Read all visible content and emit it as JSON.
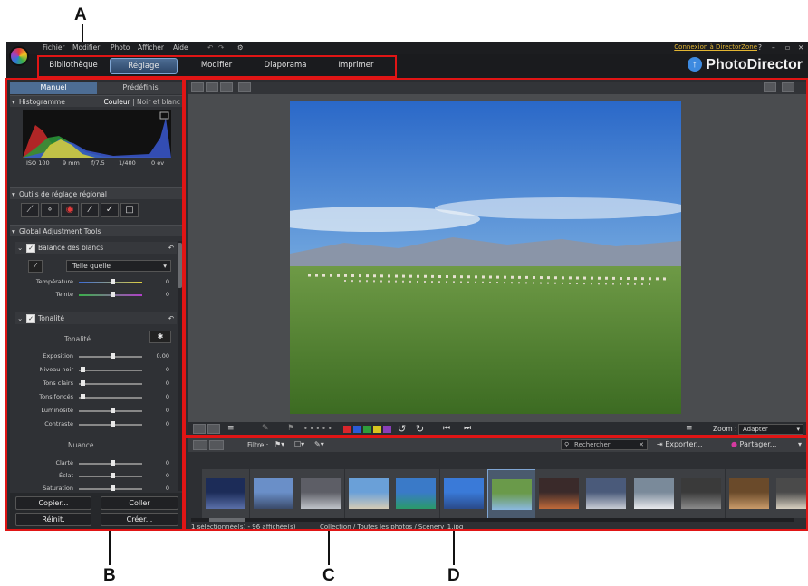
{
  "callouts": {
    "a": "A",
    "b": "B",
    "c": "C",
    "d": "D"
  },
  "menu": {
    "items": [
      "Fichier",
      "Modifier",
      "Photo",
      "Afficher",
      "Aide"
    ]
  },
  "header": {
    "directorzone_link": "Connexion à DirectorZone",
    "help": "?",
    "brand": "PhotoDirector",
    "tabs": [
      "Bibliothèque",
      "Réglage",
      "Modifier",
      "Diaporama",
      "Imprimer"
    ],
    "active_tab": "Réglage"
  },
  "left_panel": {
    "tabs": [
      "Manuel",
      "Prédéfinis"
    ],
    "histogram": {
      "title": "Histogramme",
      "mode_color": "Couleur",
      "mode_separator": "|",
      "mode_bw": "Noir et blanc",
      "exif": [
        "ISO 100",
        "9 mm",
        "f/7.5",
        "1/400",
        "0 ev"
      ]
    },
    "regional_tools_title": "Outils de réglage régional",
    "global_tools_title": "Global Adjustment Tools",
    "white_balance": {
      "title": "Balance des blancs",
      "preset": "Telle quelle",
      "sliders": [
        {
          "label": "Température",
          "value": "0"
        },
        {
          "label": "Teinte",
          "value": "0"
        }
      ]
    },
    "tonality": {
      "title": "Tonalité",
      "subtitle": "Tonalité",
      "sliders": [
        {
          "label": "Exposition",
          "value": "0.00"
        },
        {
          "label": "Niveau noir",
          "value": "0"
        },
        {
          "label": "Tons clairs",
          "value": "0"
        },
        {
          "label": "Tons foncés",
          "value": "0"
        },
        {
          "label": "Luminosité",
          "value": "0"
        },
        {
          "label": "Contraste",
          "value": "0"
        }
      ]
    },
    "nuance": {
      "title": "Nuance",
      "sliders": [
        {
          "label": "Clarté",
          "value": "0"
        },
        {
          "label": "Éclat",
          "value": "0"
        },
        {
          "label": "Saturation",
          "value": "0"
        }
      ]
    },
    "buttons": {
      "copy": "Copier...",
      "paste": "Coller",
      "reset": "Réinit.",
      "create": "Créer..."
    }
  },
  "viewer": {
    "zoom_label": "Zoom :",
    "zoom_value": "Adapter",
    "color_labels": [
      "#d9262c",
      "#2a5bd7",
      "#2f9e3a",
      "#d8c51f",
      "#8a3fb8"
    ]
  },
  "browser": {
    "filter_label": "Filtre :",
    "search_placeholder": "Rechercher",
    "export_label": "Exporter...",
    "share_label": "Partager...",
    "status_count": "1 sélectionnée(s) - 96 affichée(s)",
    "status_path": "Collection / Toutes les photos / Scenery_1.jpg"
  },
  "colors": {
    "accent": "#4d6d94",
    "callout_box": "#e01515",
    "link": "#e3b633"
  }
}
